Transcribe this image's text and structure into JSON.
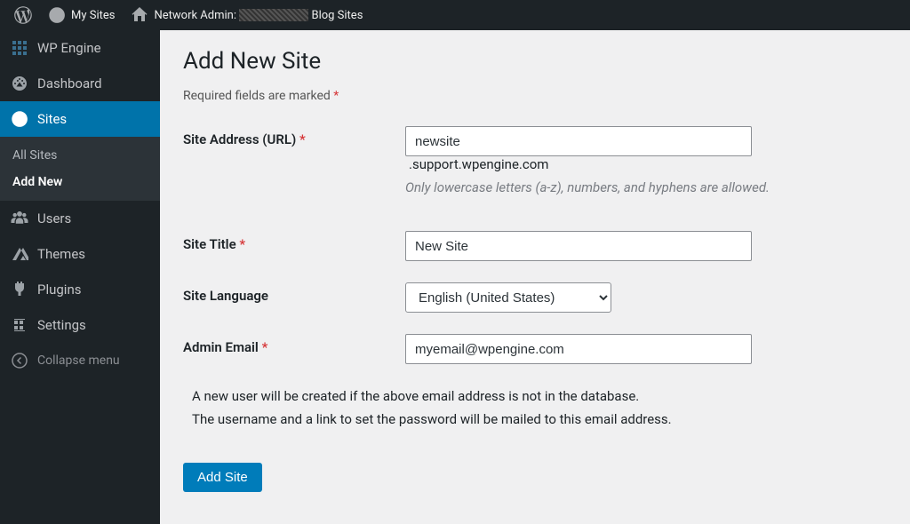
{
  "admin_bar": {
    "my_sites": "My Sites",
    "network_admin_prefix": "Network Admin:",
    "network_admin_suffix": "Blog Sites"
  },
  "sidebar": {
    "items": [
      {
        "label": "WP Engine"
      },
      {
        "label": "Dashboard"
      },
      {
        "label": "Sites"
      },
      {
        "label": "Users"
      },
      {
        "label": "Themes"
      },
      {
        "label": "Plugins"
      },
      {
        "label": "Settings"
      }
    ],
    "submenu": [
      {
        "label": "All Sites"
      },
      {
        "label": "Add New"
      }
    ],
    "collapse": "Collapse menu"
  },
  "page": {
    "title": "Add New Site",
    "required_note": "Required fields are marked",
    "asterisk": "*"
  },
  "form": {
    "site_address": {
      "label": "Site Address (URL)",
      "value": "newsite",
      "suffix": ".support.wpengine.com",
      "desc": "Only lowercase letters (a-z), numbers, and hyphens are allowed."
    },
    "site_title": {
      "label": "Site Title",
      "value": "New Site"
    },
    "site_language": {
      "label": "Site Language",
      "value": "English (United States)"
    },
    "admin_email": {
      "label": "Admin Email",
      "value": "myemail@wpengine.com"
    },
    "note_line1": "A new user will be created if the above email address is not in the database.",
    "note_line2": "The username and a link to set the password will be mailed to this email address.",
    "submit": "Add Site"
  }
}
